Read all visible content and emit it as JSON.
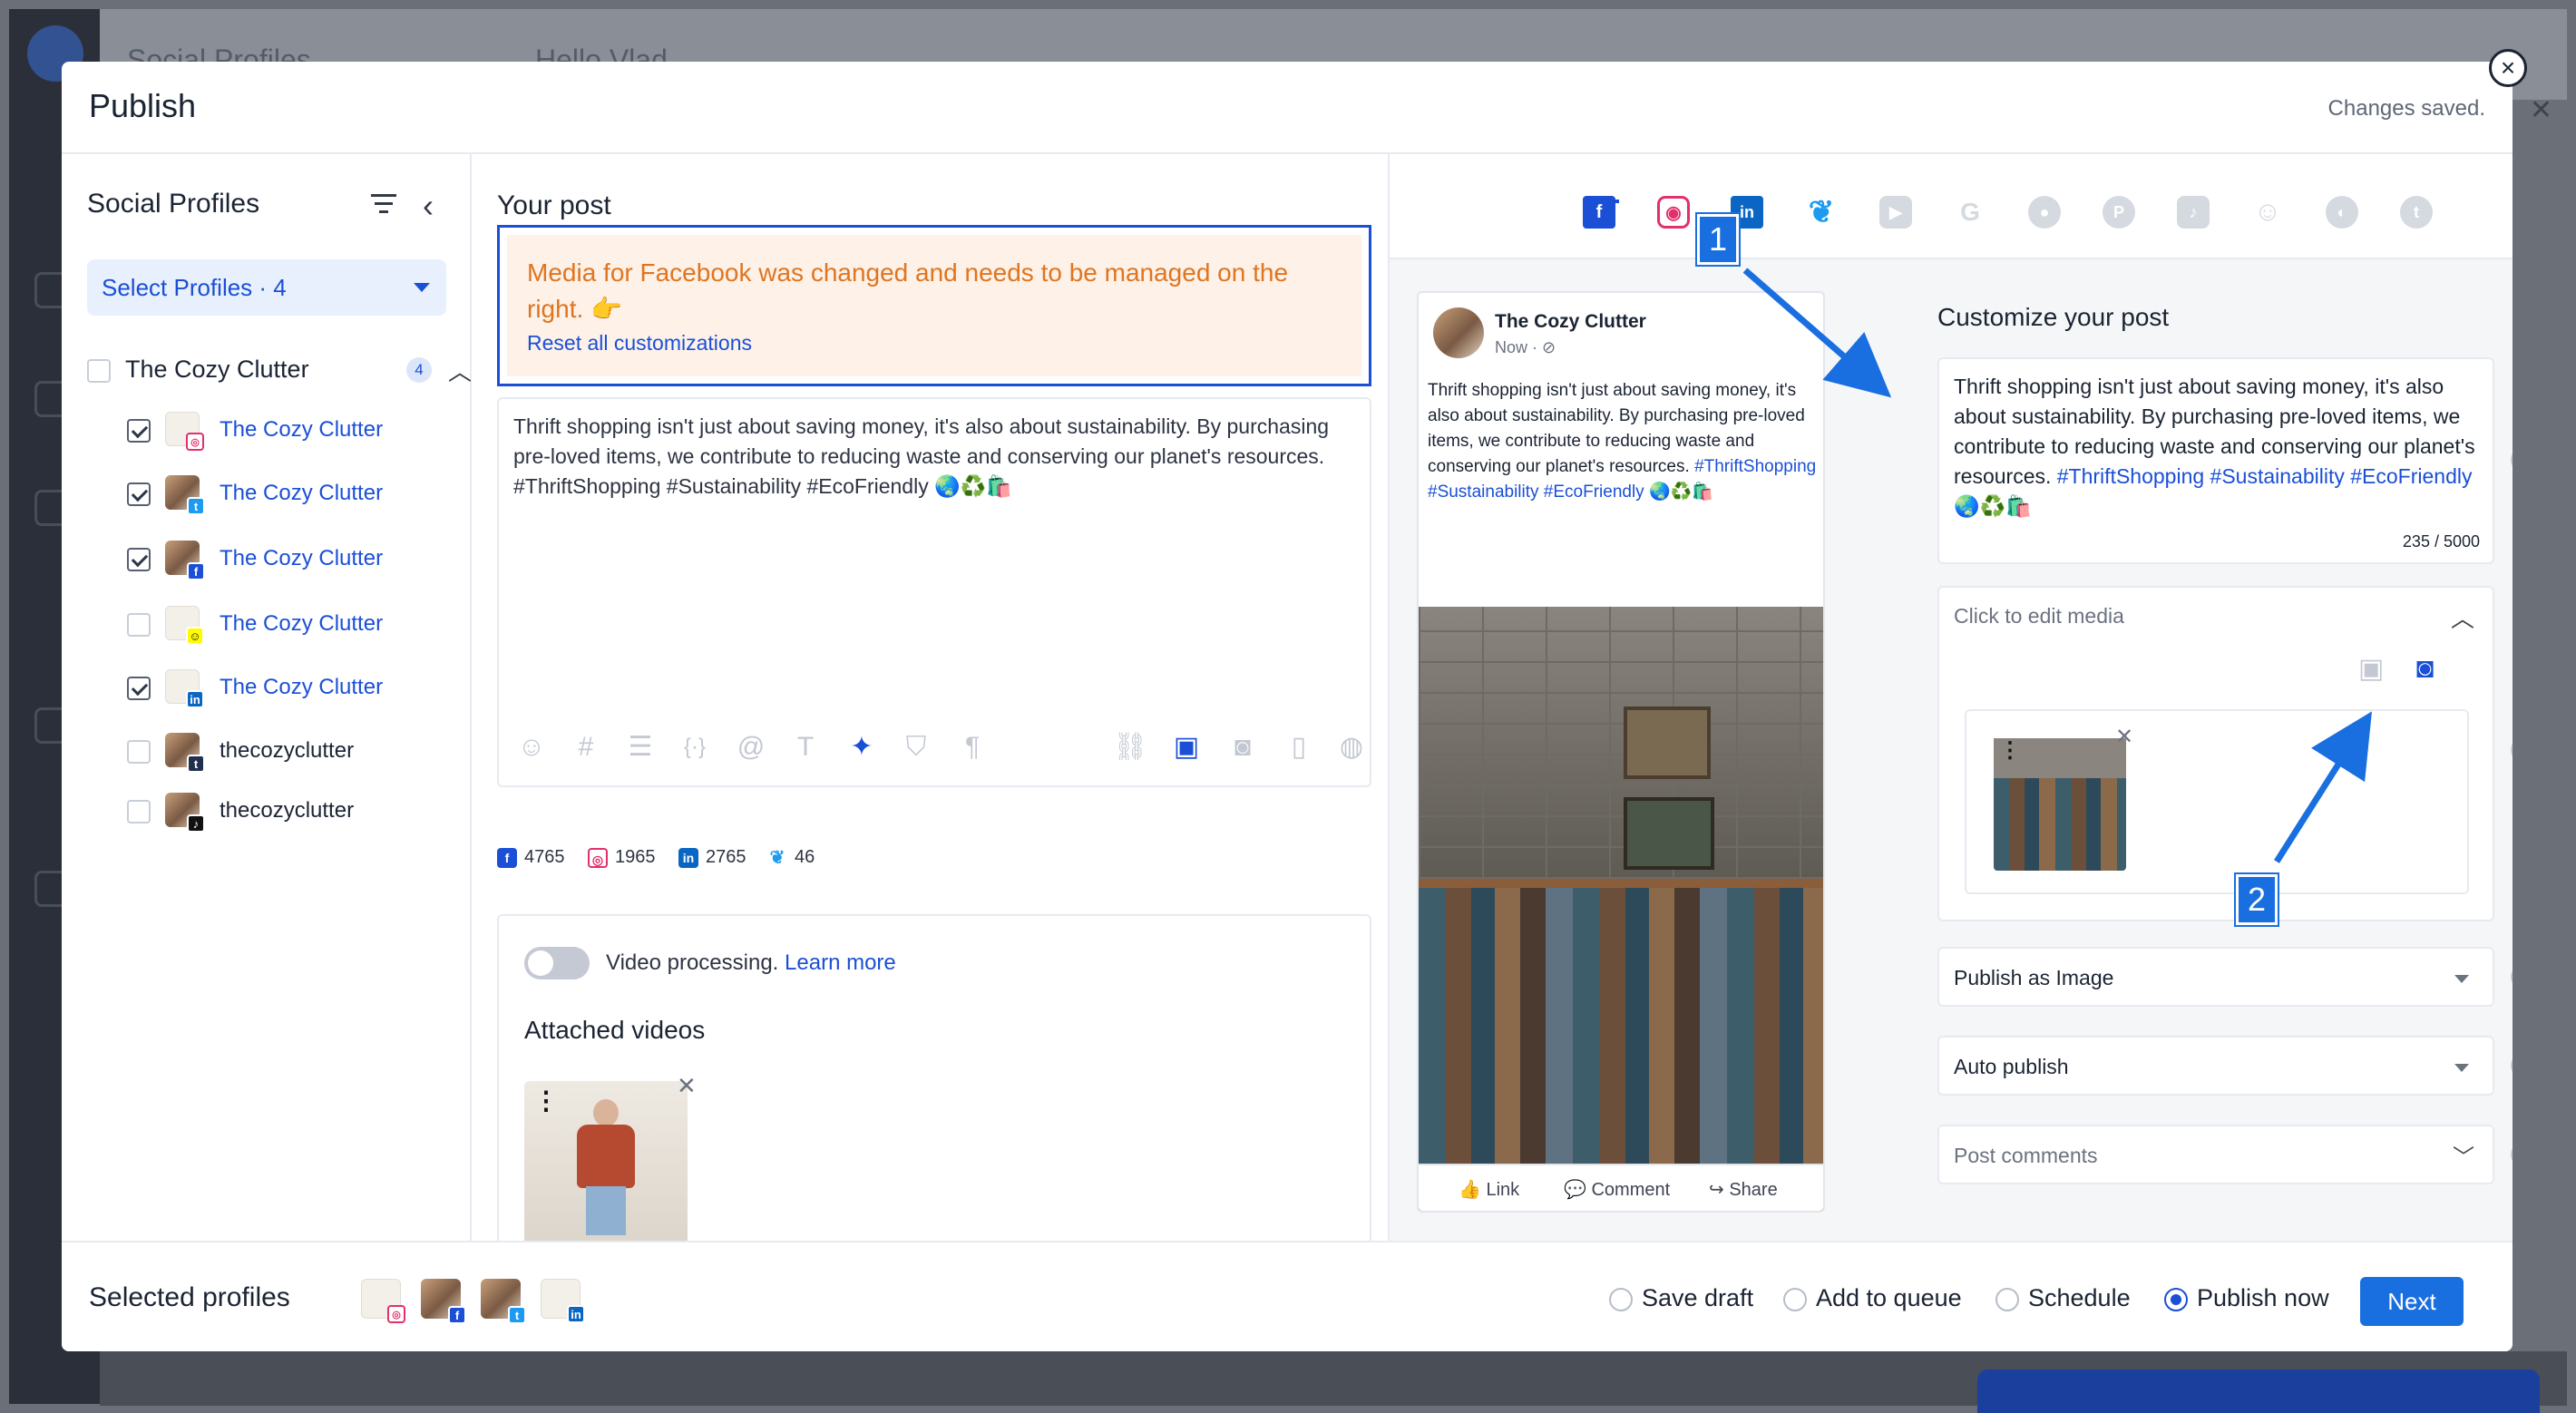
{
  "background_app": {
    "header_left": "Social Profiles",
    "header_center": "Hello Vlad"
  },
  "modal": {
    "title": "Publish",
    "status": "Changes saved.",
    "close_label": "×"
  },
  "profiles_panel": {
    "title": "Social Profiles",
    "select_label": "Select Profiles · 4",
    "group": {
      "name": "The Cozy Clutter",
      "count": "4",
      "checked": false
    },
    "profiles": [
      {
        "name": "The Cozy Clutter",
        "network": "instagram",
        "checked": true
      },
      {
        "name": "The Cozy Clutter",
        "network": "twitter",
        "checked": true
      },
      {
        "name": "The Cozy Clutter",
        "network": "facebook",
        "checked": true
      },
      {
        "name": "The Cozy Clutter",
        "network": "snapchat",
        "checked": false
      },
      {
        "name": "The Cozy Clutter",
        "network": "linkedin",
        "checked": true
      },
      {
        "name": "thecozyclutter",
        "network": "tumblr",
        "checked": false
      },
      {
        "name": "thecozyclutter",
        "network": "tiktok",
        "checked": false
      }
    ]
  },
  "post_editor": {
    "title": "Your post",
    "alert_message": "Media for Facebook was changed and needs to be managed on the right. 👉",
    "alert_reset": "Reset all customizations",
    "text": "Thrift shopping isn't just about saving money, it's also about sustainability. By purchasing pre-loved items, we contribute to reducing waste and conserving our planet's resources. #ThriftShopping #Sustainability #EcoFriendly 🌏♻️🛍️",
    "counts": [
      {
        "network": "facebook",
        "value": "4765"
      },
      {
        "network": "instagram",
        "value": "1965"
      },
      {
        "network": "linkedin",
        "value": "2765"
      },
      {
        "network": "twitter",
        "value": "46"
      }
    ],
    "video_processing": "Video processing.",
    "learn_more": "Learn more",
    "attached_videos": "Attached videos"
  },
  "preview": {
    "account_name": "The Cozy Clutter",
    "time": "Now · ⊘",
    "text_plain": "Thrift shopping isn't just about saving money, it's also about sustainability. By purchasing pre-loved items, we contribute to reducing waste and conserving our planet's resources.",
    "hashtags": "#ThriftShopping #Sustainability #EcoFriendly",
    "emojis": "🌏♻️🛍️",
    "actions": {
      "like": "Link",
      "comment": "Comment",
      "share": "Share"
    }
  },
  "customize": {
    "title": "Customize your post",
    "text_plain": "Thrift shopping isn't just about saving money, it's also about sustainability. By purchasing pre-loved items, we contribute to reducing waste and conserving our planet's resources.",
    "hashtag1": "#ThriftShopping #Sustainability",
    "hashtag2": "#EcoFriendly",
    "emojis": "🌏♻️🛍️",
    "char_count": "235 / 5000",
    "media_label": "Click to edit media",
    "publish_as": "Publish as Image",
    "auto_publish": "Auto publish",
    "post_comments": "Post comments"
  },
  "annotations": {
    "step1": "1",
    "step2": "2"
  },
  "footer": {
    "selected_label": "Selected profiles",
    "options": [
      {
        "label": "Save draft",
        "selected": false
      },
      {
        "label": "Add to queue",
        "selected": false
      },
      {
        "label": "Schedule",
        "selected": false
      },
      {
        "label": "Publish now",
        "selected": true
      }
    ],
    "next_label": "Next"
  },
  "colors": {
    "accent": "#1a4fd6",
    "alert_text": "#e0751f",
    "alert_bg": "#fdf1e8",
    "annotation": "#1a6fe0"
  }
}
